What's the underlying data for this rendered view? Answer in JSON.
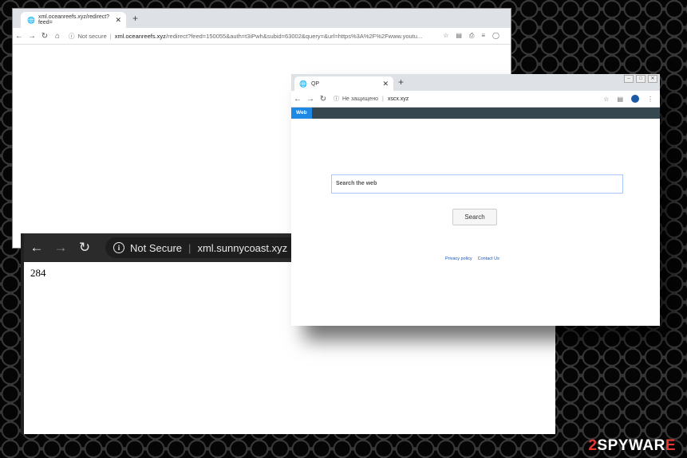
{
  "window1": {
    "tab_title": "xml.oceanreefs.xyz/redirect?feed=",
    "new_tab_icon": "+",
    "security_label": "Not secure",
    "url_host": "xml.oceanreefs.xyz",
    "url_path": "/redirect?feed=150055&auth=t3iPwh&subid=63002&query=&url=https%3A%2F%2Fwww.youtu..."
  },
  "window2": {
    "security_label": "Not Secure",
    "url_host": "xml.sunnycoast.xyz",
    "body_text": "284"
  },
  "window3": {
    "tab_title": "QP",
    "security_label": "Не защищено",
    "url_host": "xscx.xyz",
    "nav_web_label": "Web",
    "search_placeholder": "Search the web",
    "search_button": "Search",
    "link_privacy": "Privacy policy",
    "link_contact": "Contact Us"
  },
  "watermark": {
    "part1": "2",
    "part2": "SPYWAR",
    "part3": "E"
  }
}
